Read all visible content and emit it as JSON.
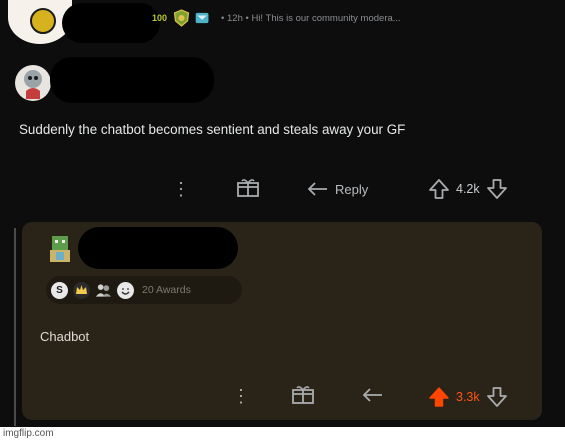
{
  "top_comment": {
    "karma": "100",
    "meta_text": "• 12h • Hi! This is our community modera..."
  },
  "comment1": {
    "body": "Suddenly the chatbot becomes sentient and steals away your GF",
    "actions": {
      "more": "⋮",
      "reply_label": "Reply",
      "score": "4.2k"
    }
  },
  "comment2": {
    "awards_count": "20 Awards",
    "body": "Chadbot",
    "actions": {
      "more": "⋮",
      "score": "3.3k",
      "upvoted_color": "#ff4500"
    }
  },
  "watermark": "imgflip.com",
  "colors": {
    "background": "#0d0d0e",
    "panel": "#2a2418",
    "karma": "#b7c72d"
  }
}
